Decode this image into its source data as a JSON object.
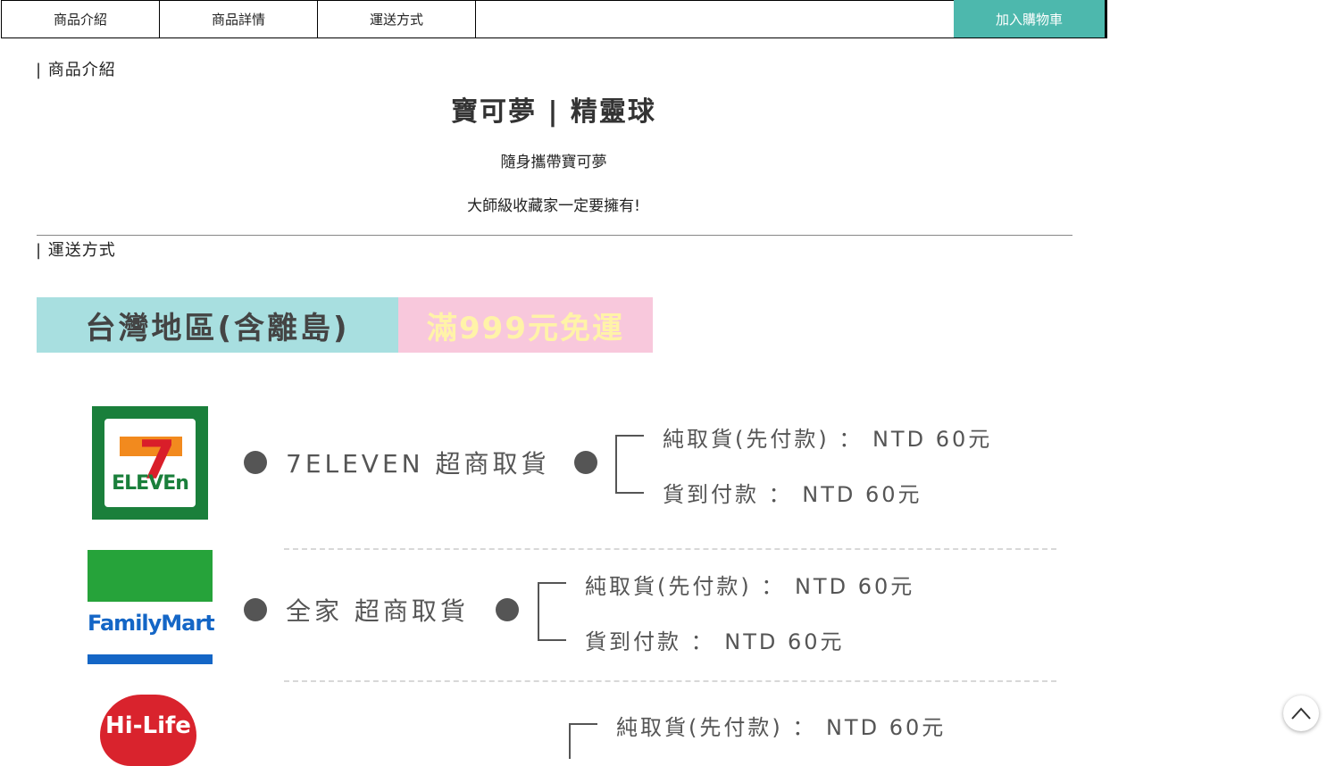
{
  "tabs": [
    {
      "label": "商品介紹"
    },
    {
      "label": "商品詳情"
    },
    {
      "label": "運送方式"
    }
  ],
  "cart_button": "加入購物車",
  "sections": {
    "intro_heading": "| 商品介紹",
    "shipping_heading": "| 運送方式"
  },
  "product": {
    "title": "寶可夢 | 精靈球",
    "line1": "隨身攜帶寶可夢",
    "line2": "大師級收藏家一定要擁有!"
  },
  "shipping": {
    "region": "台灣地區(含離島)",
    "free_shipping": "滿999元免運",
    "stores": [
      {
        "logo": "seven-eleven-logo",
        "logo_text": "ELEVEn",
        "logo_seven": "7",
        "label": "7ELEVEN 超商取貨",
        "prepaid": "純取貨(先付款) ： NTD 60元",
        "cod": "貨到付款 ： NTD 60元"
      },
      {
        "logo": "familymart-logo",
        "logo_text": "FamilyMart",
        "label": "全家 超商取貨",
        "prepaid": "純取貨(先付款) ： NTD 60元",
        "cod": "貨到付款 ： NTD 60元"
      },
      {
        "logo": "hilife-logo",
        "logo_text": "Hi-Life",
        "prepaid": "純取貨(先付款) ： NTD 60元"
      }
    ]
  },
  "colors": {
    "cart_button": "#4db8ad",
    "region_banner": "#a8dfe0",
    "free_banner": "#f8c8dc"
  },
  "icons": {
    "scroll_top": "chevron-up-icon"
  }
}
